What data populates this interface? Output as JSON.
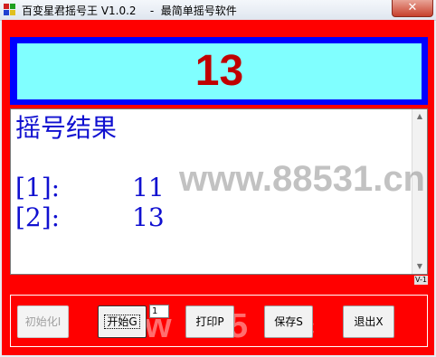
{
  "window": {
    "title": "百变星君摇号王 V1.0.2    -  最简单摇号软件",
    "close_label": "✕"
  },
  "display": {
    "current_number": "13"
  },
  "results": {
    "heading": "摇号结果",
    "entries": [
      {
        "index_label": "[1]:",
        "value": "11"
      },
      {
        "index_label": "[2]:",
        "value": "13"
      }
    ],
    "scroll_up_icon": "▲",
    "scroll_down_icon": "▼"
  },
  "version_label": "V-1",
  "controls": {
    "init_label": "初始化I",
    "start_label": "开始G",
    "count_value": "1",
    "print_label": "打印P",
    "save_label": "保存S",
    "exit_label": "退出X"
  },
  "watermark": {
    "text": "www.88531.cn",
    "bottom_text": "w  . 35  1.c"
  },
  "colors": {
    "frame": "#ff0000",
    "display_border": "#0000ff",
    "display_bg": "#80ffff",
    "number": "#c00000",
    "result_text": "#1010d0"
  }
}
